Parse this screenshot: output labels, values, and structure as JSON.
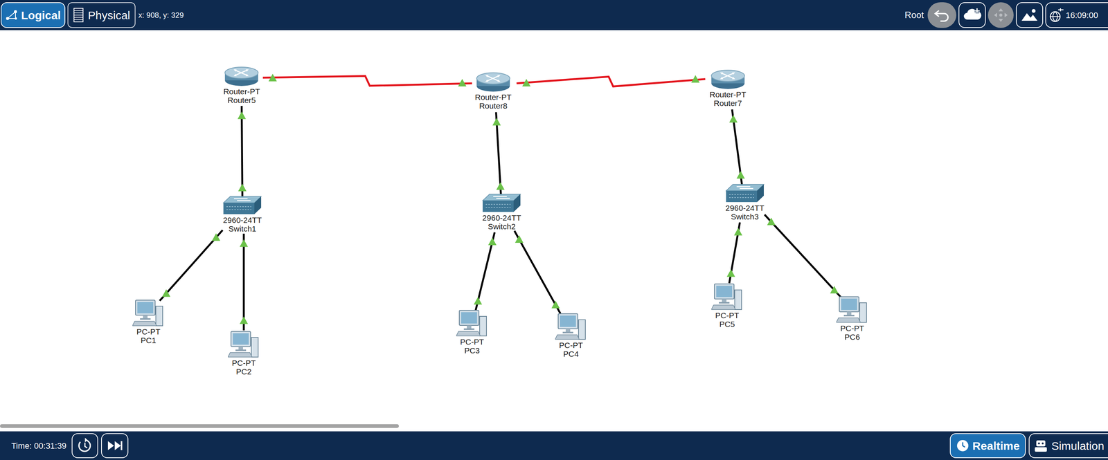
{
  "toolbar": {
    "views": [
      {
        "label": "Logical",
        "selected": true
      },
      {
        "label": "Physical",
        "selected": false
      }
    ],
    "coordinates": "x: 908, y: 329",
    "workspace": "Root",
    "clock": "16:09:00"
  },
  "devices": [
    {
      "kind": "router",
      "model": "Router-PT",
      "name": "Router5"
    },
    {
      "kind": "router",
      "model": "Router-PT",
      "name": "Router8"
    },
    {
      "kind": "router",
      "model": "Router-PT",
      "name": "Router7"
    },
    {
      "kind": "switch",
      "model": "2960-24TT",
      "name": "Switch1"
    },
    {
      "kind": "switch",
      "model": "2960-24TT",
      "name": "Switch2"
    },
    {
      "kind": "switch",
      "model": "2960-24TT",
      "name": "Switch3"
    },
    {
      "kind": "pc",
      "model": "PC-PT",
      "name": "PC1"
    },
    {
      "kind": "pc",
      "model": "PC-PT",
      "name": "PC2"
    },
    {
      "kind": "pc",
      "model": "PC-PT",
      "name": "PC3"
    },
    {
      "kind": "pc",
      "model": "PC-PT",
      "name": "PC4"
    },
    {
      "kind": "pc",
      "model": "PC-PT",
      "name": "PC5"
    },
    {
      "kind": "pc",
      "model": "PC-PT",
      "name": "PC6"
    }
  ],
  "links": [
    {
      "kind": "serial",
      "color": "#e3141c",
      "lights": [
        true,
        true
      ]
    },
    {
      "kind": "serial",
      "color": "#e3141c",
      "lights": [
        true,
        true
      ]
    },
    {
      "kind": "copper",
      "color": "#000000",
      "lights": [
        true,
        true
      ]
    },
    {
      "kind": "copper",
      "color": "#000000",
      "lights": [
        true,
        true
      ]
    },
    {
      "kind": "copper",
      "color": "#000000",
      "lights": [
        true,
        true
      ]
    },
    {
      "kind": "copper",
      "color": "#000000",
      "lights": [
        true,
        true
      ]
    },
    {
      "kind": "copper",
      "color": "#000000",
      "lights": [
        true,
        true
      ]
    },
    {
      "kind": "copper",
      "color": "#000000",
      "lights": [
        true,
        true
      ]
    },
    {
      "kind": "copper",
      "color": "#000000",
      "lights": [
        true,
        true
      ]
    },
    {
      "kind": "copper",
      "color": "#000000",
      "lights": [
        true,
        true
      ]
    },
    {
      "kind": "copper",
      "color": "#000000",
      "lights": [
        true,
        true
      ]
    }
  ],
  "scrollbar": {
    "level": 0.36
  },
  "status_bar": {
    "time": "Time: 00:31:39",
    "modes": [
      {
        "label": "Realtime",
        "selected": true
      },
      {
        "label": "Simulation",
        "selected": false
      }
    ]
  }
}
